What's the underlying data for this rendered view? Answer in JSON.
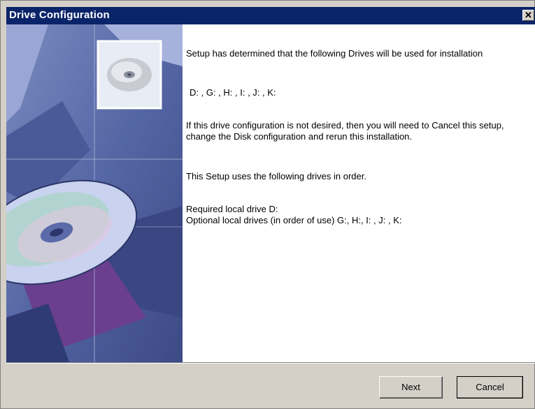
{
  "window": {
    "title": "Drive Configuration",
    "close_glyph": "✕"
  },
  "body": {
    "para1": "Setup has determined that the following Drives will be used for installation",
    "drives_list": "D: , G: , H: , I: , J: , K:",
    "para2": "If this drive configuration is not desired,  then you will need to Cancel this setup, change the Disk configuration and rerun this installation.",
    "para3": "This Setup uses the following drives in order.",
    "required_line": "Required local drive  D:",
    "optional_line": "Optional local drives (in order of use) G:, H:, I: , J: , K:"
  },
  "buttons": {
    "next_label": "Next",
    "cancel_label": "Cancel"
  },
  "icons": {
    "close": "close-icon",
    "cd": "cd-disc-icon"
  },
  "colors": {
    "titlebar": "#0a246a",
    "dialog_face": "#d4d0c8",
    "art_blue": "#5c6ea8"
  }
}
